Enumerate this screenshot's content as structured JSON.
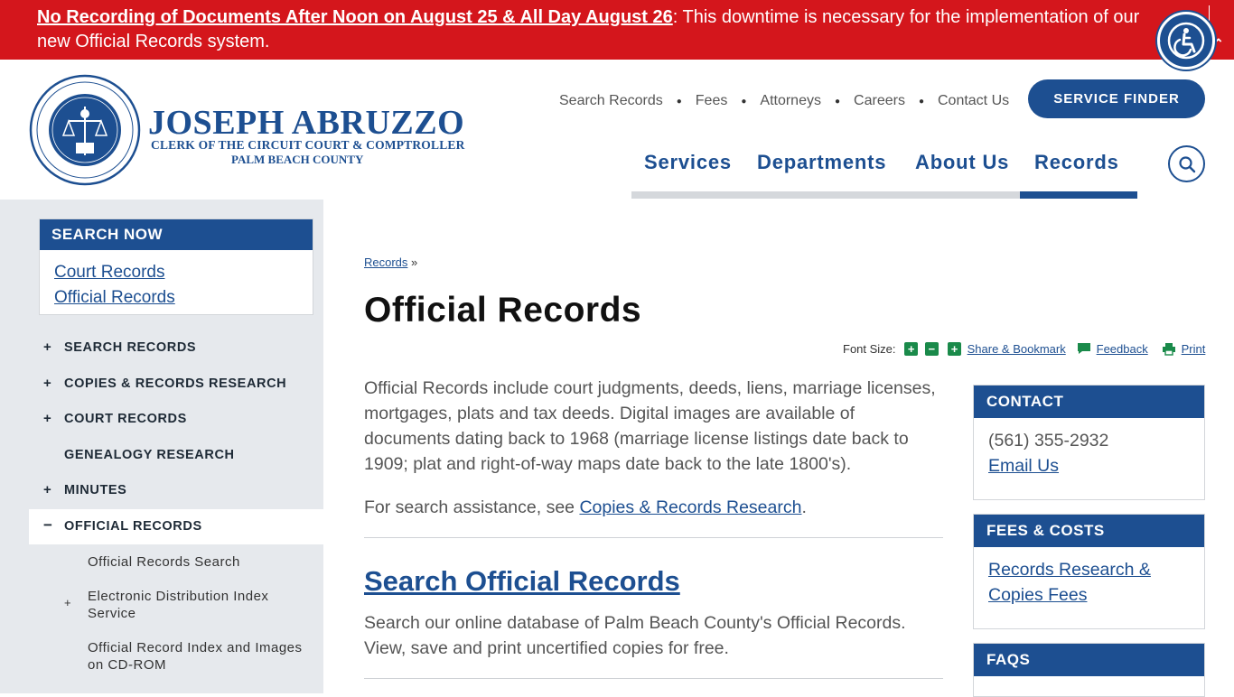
{
  "alert": {
    "bold_link": "No Recording of Documents After Noon on August 25 & All Day August 26",
    "text": ": This downtime is necessary for the implementation of our new Official Records system."
  },
  "logo": {
    "name": "JOSEPH ABRUZZO",
    "subtitle1": "CLERK OF THE CIRCUIT COURT & COMPTROLLER",
    "subtitle2": "PALM BEACH COUNTY"
  },
  "util_nav": [
    "Search Records",
    "Fees",
    "Attorneys",
    "Careers",
    "Contact Us"
  ],
  "service_finder": "SERVICE FINDER",
  "main_nav": [
    "Services",
    "Departments",
    "About Us",
    "Records"
  ],
  "search_now": {
    "title": "SEARCH NOW",
    "links": [
      "Court Records",
      "Official Records"
    ]
  },
  "sidebar": {
    "items": [
      {
        "label": "SEARCH RECORDS",
        "expand": "+"
      },
      {
        "label": "COPIES & RECORDS RESEARCH",
        "expand": "+"
      },
      {
        "label": "COURT RECORDS",
        "expand": "+"
      },
      {
        "label": "GENEALOGY RESEARCH",
        "expand": ""
      },
      {
        "label": "MINUTES",
        "expand": "+"
      },
      {
        "label": "OFFICIAL RECORDS",
        "expand": "−"
      }
    ],
    "subitems": [
      {
        "label": "Official Records Search",
        "expand": ""
      },
      {
        "label": "Electronic Distribution Index Service",
        "expand": "+"
      },
      {
        "label": "Official Record Index and Images on CD-ROM",
        "expand": ""
      }
    ]
  },
  "breadcrumb": {
    "link": "Records",
    "sep": "»"
  },
  "page_title": "Official Records",
  "tools": {
    "font_size": "Font Size:",
    "share": "Share & Bookmark",
    "feedback": "Feedback",
    "print": "Print"
  },
  "content": {
    "intro": "Official Records include court judgments, deeds, liens, marriage licenses, mortgages, plats and tax deeds. Digital images are available of documents dating back to 1968 (marriage license listings date back to 1909; plat and right-of-way maps date back to the late 1800's).",
    "assist_prefix": "For search assistance, see ",
    "assist_link": "Copies & Records Research",
    "assist_suffix": ".",
    "section_title": "Search Official Records",
    "section_text": "Search our online database of Palm Beach County's Official Records. View, save and print uncertified copies for free."
  },
  "contact": {
    "title": "CONTACT",
    "phone": "(561) 355-2932",
    "email": "Email Us"
  },
  "fees": {
    "title": "FEES & COSTS",
    "link": "Records Research & Copies Fees"
  },
  "faqs": {
    "title": "FAQS"
  },
  "colors": {
    "brand_blue": "#1d4f91",
    "alert_red": "#d4161c",
    "tool_green": "#1a8a4a"
  }
}
